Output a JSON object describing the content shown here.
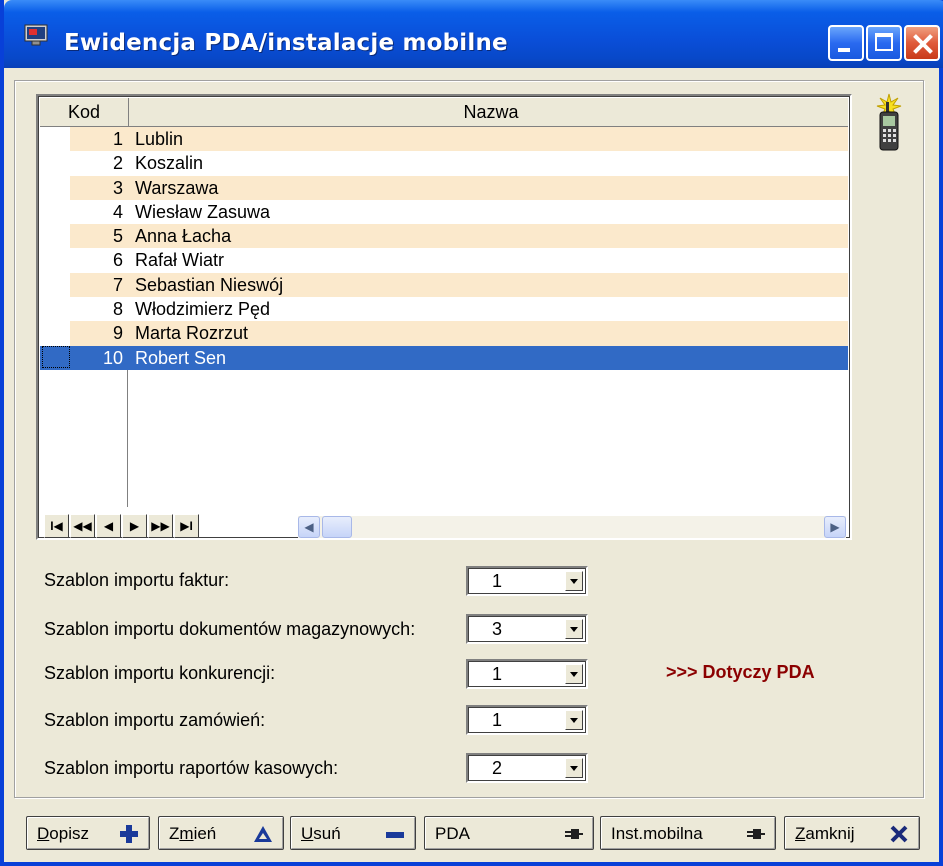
{
  "window": {
    "title": "Ewidencja PDA/instalacje mobilne",
    "icon": "monitor-icon",
    "titlebar_color": "#0a5ee8"
  },
  "grid": {
    "columns": [
      "Kod",
      "Nazwa"
    ],
    "rows": [
      {
        "kod": "1",
        "nazwa": "Lublin"
      },
      {
        "kod": "2",
        "nazwa": "Koszalin"
      },
      {
        "kod": "3",
        "nazwa": "Warszawa"
      },
      {
        "kod": "4",
        "nazwa": "Wiesław Zasuwa"
      },
      {
        "kod": "5",
        "nazwa": "Anna Łacha"
      },
      {
        "kod": "6",
        "nazwa": "Rafał Wiatr"
      },
      {
        "kod": "7",
        "nazwa": "Sebastian Nieswój"
      },
      {
        "kod": "8",
        "nazwa": "Włodzimierz Pęd"
      },
      {
        "kod": "9",
        "nazwa": "Marta Rozrzut"
      },
      {
        "kod": "10",
        "nazwa": "Robert Sen"
      }
    ],
    "selected_kod": "10",
    "row_alt_color": "#fbe9cc",
    "selected_color": "#316ac5",
    "nav": [
      "I◀",
      "◀◀",
      "◀",
      "▶",
      "▶▶",
      "▶I"
    ]
  },
  "fields": [
    {
      "label": "Szablon importu faktur:",
      "value": "1"
    },
    {
      "label": "Szablon importu dokumentów magazynowych:",
      "value": "3"
    },
    {
      "label": "Szablon importu konkurencji:",
      "value": "1"
    },
    {
      "label": "Szablon importu zamówień:",
      "value": "1"
    },
    {
      "label": "Szablon importu raportów kasowych:",
      "value": "2"
    }
  ],
  "note": ">>> Dotyczy PDA",
  "buttons": {
    "dopisz": {
      "hot": "D",
      "rest": "opisz",
      "icon": "plus-icon"
    },
    "zmien": {
      "hot": "m",
      "pre": "Z",
      "rest": "ień",
      "icon": "triangle-icon"
    },
    "usun": {
      "hot": "U",
      "rest": "suń",
      "icon": "minus-icon"
    },
    "pda": {
      "label": "PDA",
      "icon": "plug-icon"
    },
    "inst": {
      "label": "Inst.mobilna",
      "icon": "plug-icon"
    },
    "zamknij": {
      "hot": "Z",
      "rest": "amknij",
      "icon": "close-x-icon"
    }
  }
}
